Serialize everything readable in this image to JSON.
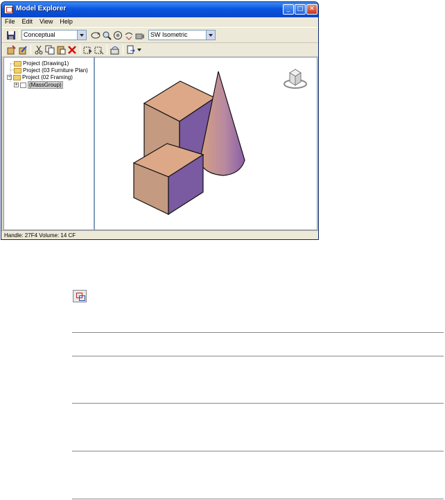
{
  "window": {
    "title": "Model Explorer"
  },
  "menu": [
    {
      "label": "File"
    },
    {
      "label": "Edit"
    },
    {
      "label": "View"
    },
    {
      "label": "Help"
    }
  ],
  "toolbar": {
    "visual_style": "Conceptual",
    "view_direction": "SW Isometric"
  },
  "tree": {
    "items": [
      {
        "label": "Project (Drawing1)"
      },
      {
        "label": "Project (03 Furniture Plan)"
      },
      {
        "label": "Project (02 Framing)"
      },
      {
        "label": "(MassGroup)"
      }
    ]
  },
  "status": {
    "text": "Handle: 27F4  Volume: 14 CF"
  },
  "colors": {
    "face_tan": "#c49a80",
    "face_top": "#d8a887",
    "face_purple": "#7a5aa0",
    "titlebar": "#0a54e0"
  }
}
